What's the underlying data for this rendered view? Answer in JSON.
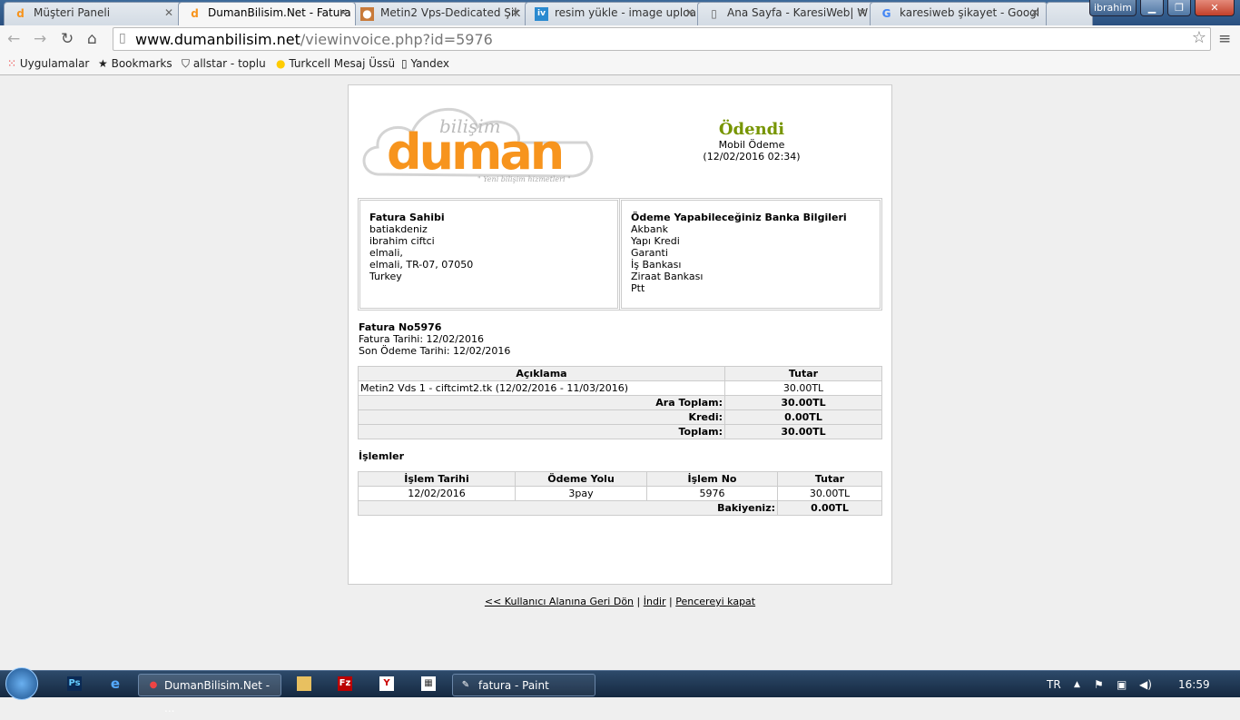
{
  "browser": {
    "tabs": [
      {
        "title": "Müşteri Paneli",
        "icon": "duman-icon"
      },
      {
        "title": "DumanBilisim.Net - Fatura",
        "icon": "duman-icon",
        "active": true
      },
      {
        "title": "Metin2 Vps-Dedicated Şik",
        "icon": "forum-icon"
      },
      {
        "title": "resim yükle - image uploa",
        "icon": "iv-icon"
      },
      {
        "title": "Ana Sayfa - KaresiWeb| W",
        "icon": "page-icon"
      },
      {
        "title": "karesiweb şikayet - Googl",
        "icon": "google-icon"
      }
    ],
    "profile": "ibrahim",
    "url_domain": "www.dumanbilisim.net",
    "url_path": "/viewinvoice.php?id=5976",
    "bookmarks": [
      "Uygulamalar",
      "Bookmarks",
      "allstar - toplu",
      "Turkcell Mesaj Üssü",
      "Yandex"
    ]
  },
  "invoice": {
    "logo": {
      "brand": "duman",
      "sub": "bilişim",
      "tagline": "\" Yeni bilişim hizmetleri \""
    },
    "status": "Ödendi",
    "method": "Mobil Ödeme",
    "paid_at": "(12/02/2016 02:34)",
    "owner": {
      "title": "Fatura Sahibi",
      "lines": [
        "batiakdeniz",
        "ibrahim ciftci",
        "elmali,",
        "elmali, TR-07, 07050",
        "Turkey"
      ]
    },
    "banks": {
      "title": "Ödeme Yapabileceğiniz Banka Bilgileri",
      "lines": [
        "Akbank",
        "Yapı Kredi",
        "Garanti",
        "İş Bankası",
        "Ziraat Bankası",
        "Ptt"
      ]
    },
    "number": "Fatura No5976",
    "date": "Fatura Tarihi: 12/02/2016",
    "due": "Son Ödeme Tarihi: 12/02/2016",
    "items": {
      "headers": [
        "Açıklama",
        "Tutar"
      ],
      "rows": [
        {
          "desc": "Metin2 Vds 1 - ciftcimt2.tk (12/02/2016 - 11/03/2016)",
          "amount": "30.00TL"
        }
      ],
      "subtotal_label": "Ara Toplam:",
      "subtotal": "30.00TL",
      "credit_label": "Kredi:",
      "credit": "0.00TL",
      "total_label": "Toplam:",
      "total": "30.00TL"
    },
    "transactions_title": "İşlemler",
    "transactions": {
      "headers": [
        "İşlem Tarihi",
        "Ödeme Yolu",
        "İşlem No",
        "Tutar"
      ],
      "rows": [
        {
          "date": "12/02/2016",
          "method": "3pay",
          "id": "5976",
          "amount": "30.00TL"
        }
      ],
      "balance_label": "Bakiyeniz:",
      "balance": "0.00TL"
    }
  },
  "links": {
    "back": "<< Kullanıcı Alanına Geri Dön",
    "sep": "|",
    "download": "İndir",
    "close": "Pencereyi kapat"
  },
  "taskbar": {
    "chrome": "DumanBilisim.Net - ...",
    "paint": "fatura - Paint",
    "lang": "TR",
    "time": "16:59"
  },
  "colors": {
    "paid": "#779500",
    "brand": "#f7941d"
  }
}
